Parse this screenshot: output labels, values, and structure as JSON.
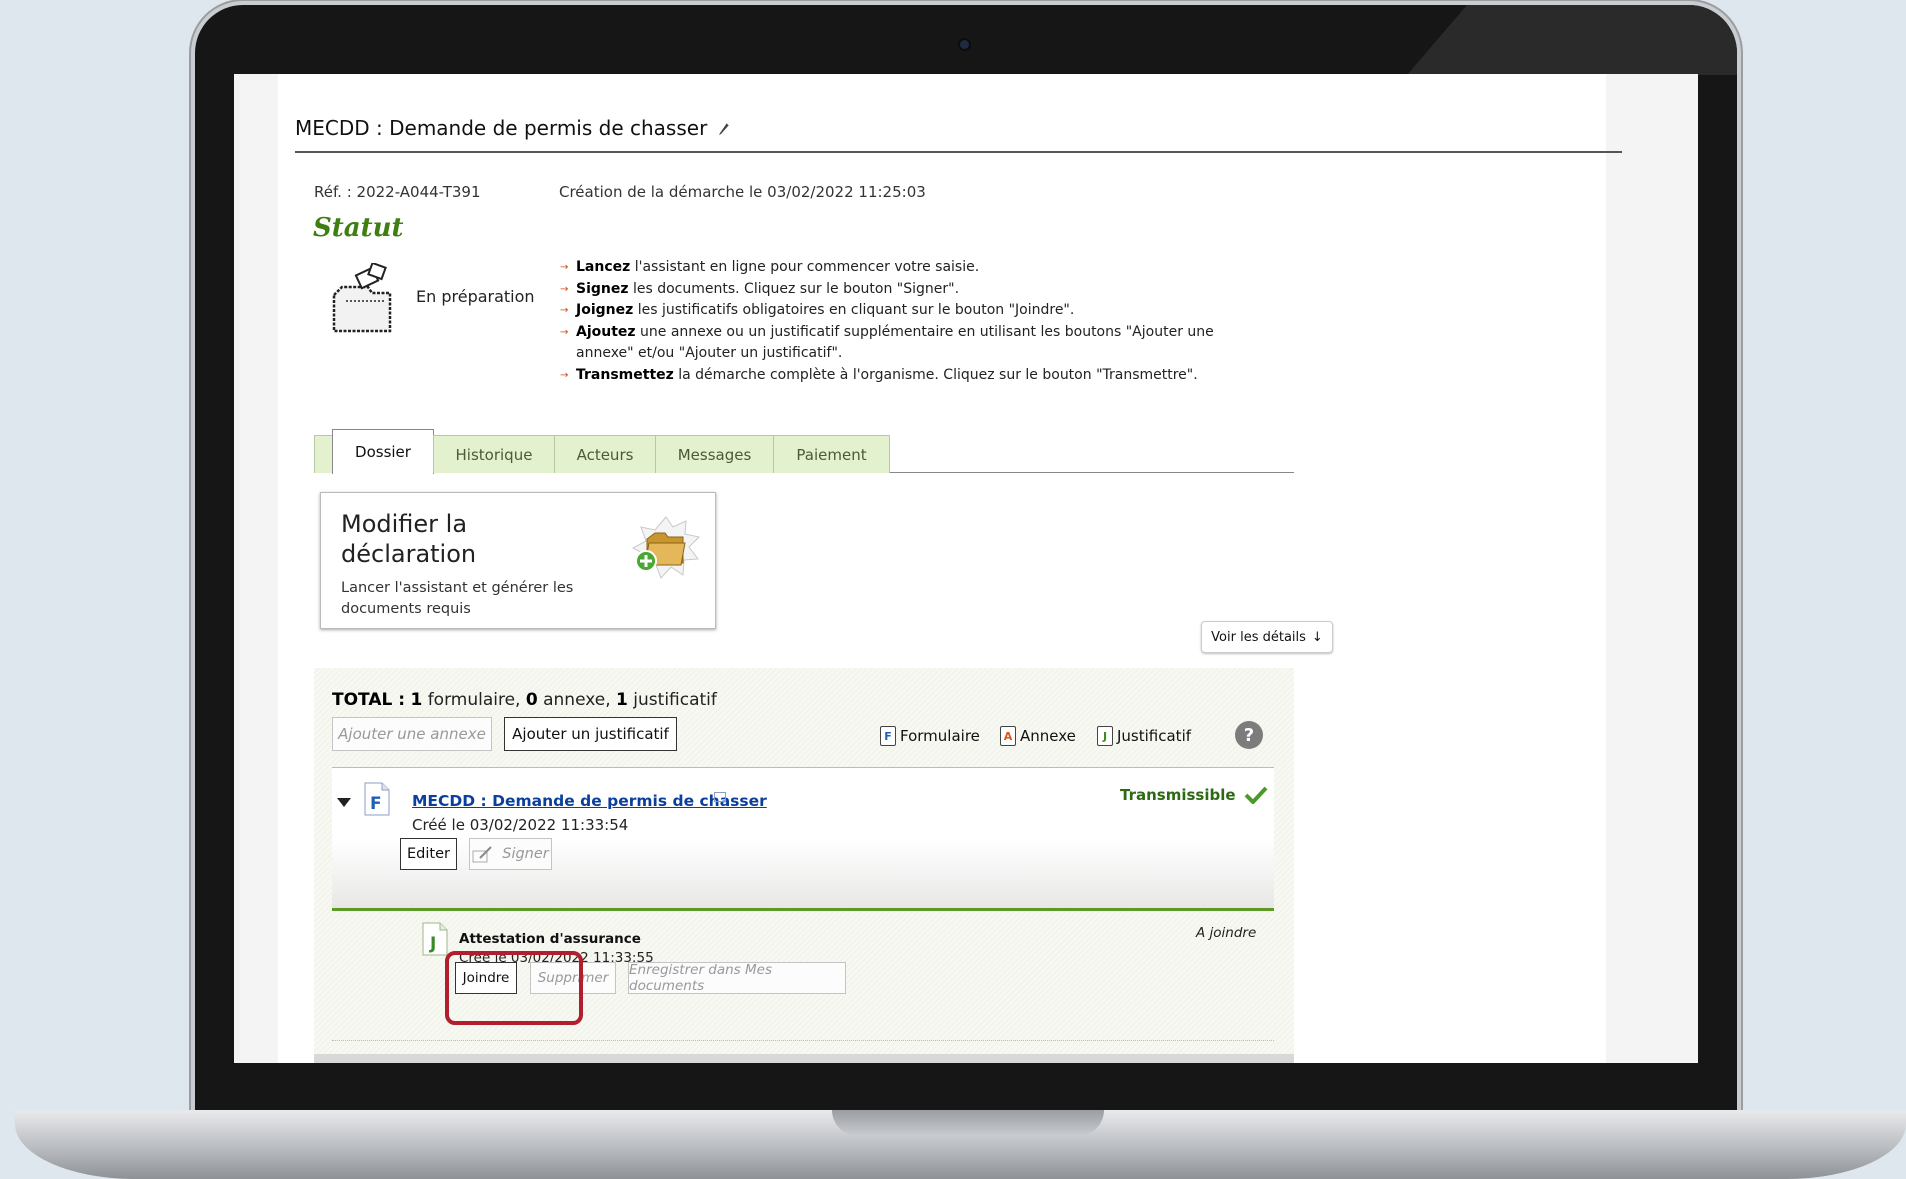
{
  "page": {
    "title": "MECDD : Demande de permis de chasser",
    "reference": "Réf. : 2022-A044-T391",
    "creation": "Création de la démarche le 03/02/2022 11:25:03",
    "statut_heading": "Statut",
    "state": "En préparation"
  },
  "steps": [
    {
      "bold": "Lancez",
      "text": " l'assistant en ligne pour commencer votre saisie."
    },
    {
      "bold": "Signez",
      "text": " les documents. Cliquez sur le bouton \"Signer\"."
    },
    {
      "bold": "Joignez",
      "text": " les justificatifs obligatoires en cliquant sur le bouton \"Joindre\"."
    },
    {
      "bold": "Ajoutez",
      "text": " une annexe ou un justificatif supplémentaire en utilisant les boutons \"Ajouter une annexe\" et/ou \"Ajouter un justificatif\"."
    },
    {
      "bold": "Transmettez",
      "text": " la démarche complète à l'organisme. Cliquez sur le bouton \"Transmettre\"."
    }
  ],
  "tabs": [
    "Dossier",
    "Historique",
    "Acteurs",
    "Messages",
    "Paiement"
  ],
  "card": {
    "title": "Modifier la déclaration",
    "subtitle": "Lancer l'assistant et générer les documents requis"
  },
  "details_button": "Voir les détails",
  "total": {
    "label": "TOTAL :",
    "formulaire_count": "1",
    "formulaire_label": "formulaire,",
    "annexe_count": "0",
    "annexe_label": "annexe,",
    "justificatif_count": "1",
    "justificatif_label": "justificatif"
  },
  "buttons": {
    "add_annexe": "Ajouter une annexe",
    "add_justificatif": "Ajouter un justificatif",
    "edit": "Editer",
    "sign": "Signer",
    "attach": "Joindre",
    "delete": "Supprimer",
    "save_docs": "Enregistrer dans Mes documents"
  },
  "legend": [
    {
      "letter": "F",
      "label": "Formulaire",
      "color": "#1f5fb8"
    },
    {
      "letter": "A",
      "label": "Annexe",
      "color": "#d9541a"
    },
    {
      "letter": "J",
      "label": "Justificatif",
      "color": "#3d8a2a"
    }
  ],
  "help_symbol": "?",
  "document": {
    "title": "MECDD : Demande de permis de chasser",
    "created": "Créé le 03/02/2022 11:33:54",
    "status": "Transmissible"
  },
  "attachment": {
    "title": "Attestation d'assurance",
    "created": "Créé le 03/02/2022 11:33:55",
    "status": "A joindre"
  },
  "colors": {
    "accent_green": "#3f7f12",
    "highlight_red": "#b11e2d",
    "link_blue": "#0b3f9e"
  }
}
